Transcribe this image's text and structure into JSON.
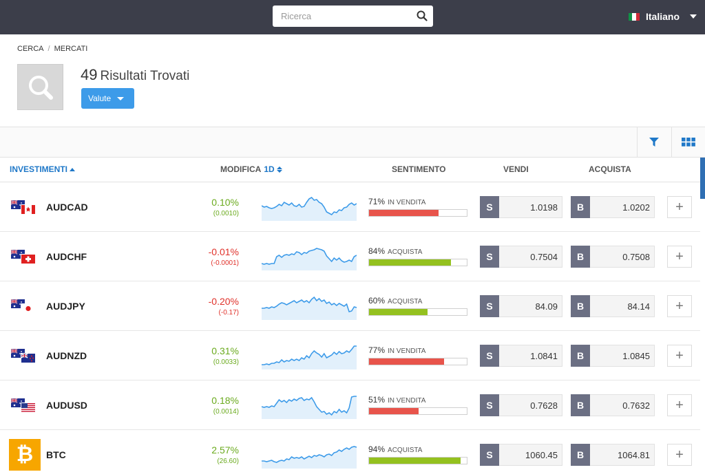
{
  "topbar": {
    "search_placeholder": "Ricerca",
    "language": "Italiano"
  },
  "breadcrumb": [
    "CERCA",
    "MERCATI"
  ],
  "results": {
    "count": "49",
    "label": "Risultati Trovati"
  },
  "filter_dropdown": "Valute",
  "columns": {
    "investments": "INVESTIMENTI",
    "change": "MODIFICA",
    "period": "1D",
    "sentiment": "SENTIMENTO",
    "sell": "VENDI",
    "buy": "ACQUISTA"
  },
  "colors": {
    "positive": "#6aaa1d",
    "negative": "#e0312a",
    "sentiment_sell": "#e8544b",
    "sentiment_buy": "#94c11f",
    "accent": "#3d9be9"
  },
  "rows": [
    {
      "symbol": "AUDCAD",
      "flags": [
        "AU",
        "CA"
      ],
      "change_pct": "0.10%",
      "change_abs": "(0.0010)",
      "direction": "pos",
      "sentiment_pct": "71%",
      "sentiment_label": "IN VENDITA",
      "sentiment_side": "sell",
      "sentiment_value": 71,
      "sell_tag": "S",
      "sell_price": "1.0198",
      "buy_tag": "B",
      "buy_price": "1.0202",
      "spark": [
        14,
        16,
        15,
        17,
        18,
        17,
        15,
        12,
        14,
        9,
        11,
        13,
        10,
        14,
        15,
        12,
        16,
        15,
        9,
        4,
        2,
        6,
        5,
        9,
        11,
        16,
        23,
        25,
        27,
        23,
        24,
        20,
        21,
        17,
        16,
        12,
        10,
        13,
        11
      ]
    },
    {
      "symbol": "AUDCHF",
      "flags": [
        "AU",
        "CH"
      ],
      "change_pct": "-0.01%",
      "change_abs": "(-0.0001)",
      "direction": "neg",
      "sentiment_pct": "84%",
      "sentiment_label": "ACQUISTA",
      "sentiment_side": "buy",
      "sentiment_value": 84,
      "sell_tag": "S",
      "sell_price": "0.7504",
      "buy_tag": "B",
      "buy_price": "0.7508",
      "spark": [
        26,
        27,
        26,
        27,
        26,
        26,
        16,
        14,
        17,
        14,
        13,
        14,
        12,
        13,
        9,
        10,
        13,
        10,
        11,
        8,
        7,
        6,
        4,
        5,
        6,
        8,
        15,
        19,
        23,
        18,
        21,
        18,
        22,
        24,
        23,
        21,
        23,
        16,
        14
      ]
    },
    {
      "symbol": "AUDJPY",
      "flags": [
        "AU",
        "JP"
      ],
      "change_pct": "-0.20%",
      "change_abs": "(-0.17)",
      "direction": "neg",
      "sentiment_pct": "60%",
      "sentiment_label": "ACQUISTA",
      "sentiment_side": "buy",
      "sentiment_value": 60,
      "sell_tag": "S",
      "sell_price": "84.09",
      "buy_tag": "B",
      "buy_price": "84.14",
      "spark": [
        19,
        19,
        18,
        19,
        17,
        18,
        16,
        13,
        11,
        12,
        14,
        12,
        10,
        8,
        11,
        9,
        7,
        10,
        8,
        11,
        6,
        3,
        8,
        5,
        9,
        7,
        12,
        10,
        14,
        12,
        15,
        12,
        14,
        16,
        13,
        24,
        23,
        17,
        18
      ]
    },
    {
      "symbol": "AUDNZD",
      "flags": [
        "AU",
        "NZ"
      ],
      "change_pct": "0.31%",
      "change_abs": "(0.0033)",
      "direction": "pos",
      "sentiment_pct": "77%",
      "sentiment_label": "IN VENDITA",
      "sentiment_side": "sell",
      "sentiment_value": 77,
      "sell_tag": "S",
      "sell_price": "1.0841",
      "buy_tag": "B",
      "buy_price": "1.0845",
      "spark": [
        29,
        29,
        28,
        29,
        27,
        27,
        25,
        26,
        22,
        25,
        23,
        24,
        21,
        23,
        21,
        23,
        19,
        21,
        16,
        19,
        13,
        9,
        12,
        14,
        18,
        13,
        19,
        17,
        15,
        11,
        14,
        10,
        13,
        12,
        9,
        11,
        7,
        2,
        2
      ]
    },
    {
      "symbol": "AUDUSD",
      "flags": [
        "AU",
        "US"
      ],
      "change_pct": "0.18%",
      "change_abs": "(0.0014)",
      "direction": "pos",
      "sentiment_pct": "51%",
      "sentiment_label": "IN VENDITA",
      "sentiment_side": "sell",
      "sentiment_value": 51,
      "sell_tag": "S",
      "sell_price": "0.7628",
      "buy_tag": "B",
      "buy_price": "0.7632",
      "spark": [
        18,
        19,
        18,
        19,
        17,
        18,
        13,
        8,
        11,
        9,
        12,
        8,
        10,
        7,
        9,
        6,
        5,
        9,
        7,
        8,
        5,
        11,
        18,
        22,
        26,
        25,
        29,
        27,
        30,
        25,
        27,
        22,
        26,
        24,
        27,
        20,
        4,
        3,
        3
      ]
    },
    {
      "symbol": "BTC",
      "flags": [],
      "coin": "₿",
      "change_pct": "2.57%",
      "change_abs": "(26.60)",
      "direction": "pos",
      "sentiment_pct": "94%",
      "sentiment_label": "ACQUISTA",
      "sentiment_side": "buy",
      "sentiment_value": 94,
      "sell_tag": "S",
      "sell_price": "1060.45",
      "buy_tag": "B",
      "buy_price": "1064.81",
      "spark": [
        25,
        25,
        26,
        25,
        24,
        26,
        27,
        25,
        24,
        25,
        22,
        23,
        19,
        21,
        20,
        21,
        19,
        22,
        20,
        18,
        20,
        17,
        18,
        16,
        17,
        19,
        16,
        15,
        17,
        13,
        12,
        9,
        11,
        8,
        6,
        8,
        5,
        4,
        5
      ]
    }
  ]
}
